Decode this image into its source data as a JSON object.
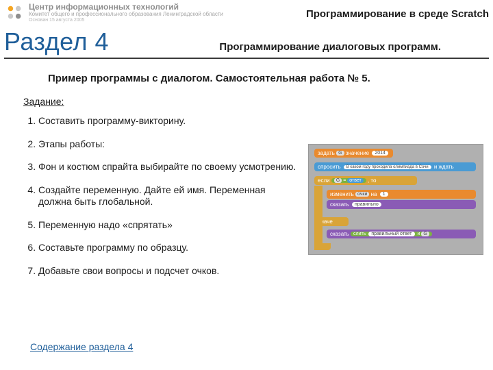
{
  "brand": {
    "line1": "Центр информационных технологий",
    "line2": "Комитет общего и профессионального образования Ленинградской области",
    "line3": "Основан 15 августа 2005"
  },
  "header": {
    "course": "Программирование в среде Scratch",
    "section": "Раздел 4",
    "subtitle": "Программирование диалоговых программ."
  },
  "content": {
    "title": "Пример программы с диалогом. Самостоятельная работа № 5.",
    "task_label": "Задание:"
  },
  "tasks": [
    "Составить программу-викторину.",
    "Этапы работы:",
    "Фон и костюм спрайта выбирайте по своему усмотрению.",
    "Создайте переменную. Дайте ей имя. Переменная должна быть глобальной.",
    "Переменную надо «спрятать»",
    "Составьте программу по образцу.",
    "Добавьте свои вопросы и подсчет очков."
  ],
  "scratch": {
    "set_label": "задать",
    "set_var": "G",
    "set_mid": "значение",
    "set_val": "2014",
    "ask_label": "спросить",
    "ask_text": "В каком году проходила олимпиада в Сочи",
    "ask_wait": "и ждать",
    "if_label": "если",
    "if_var": "G",
    "if_eq": "=",
    "if_answer": "ответ",
    "if_then": ", то",
    "change_label": "изменить",
    "change_var": "очки",
    "change_by": "на",
    "change_val": "1",
    "say1_label": "сказать",
    "say1_text": "правильно",
    "else_label": "иначе",
    "say2_label": "сказать",
    "join_label": "слить",
    "join_a": "правильный ответ",
    "join_and": "и",
    "join_b": "G"
  },
  "footer": {
    "back": "Содержание раздела 4"
  }
}
